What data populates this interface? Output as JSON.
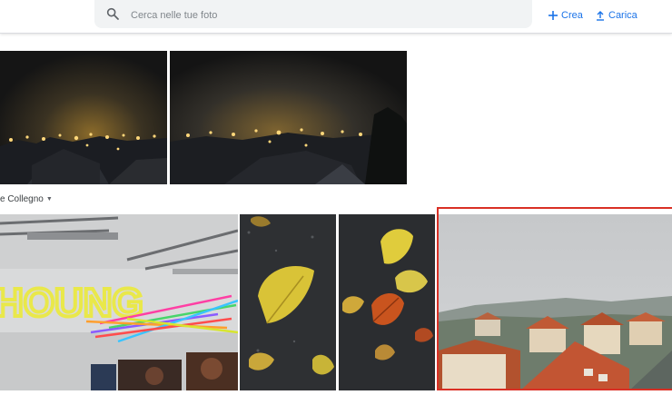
{
  "search": {
    "placeholder": "Cerca nelle tue foto",
    "icon": "search-icon"
  },
  "actions": {
    "create_label": "Crea",
    "upload_label": "Carica"
  },
  "section": {
    "title": "e Collegno"
  },
  "sign_text": "HOUNG",
  "colors": {
    "accent": "#1a73e8",
    "selection": "#d93025"
  }
}
